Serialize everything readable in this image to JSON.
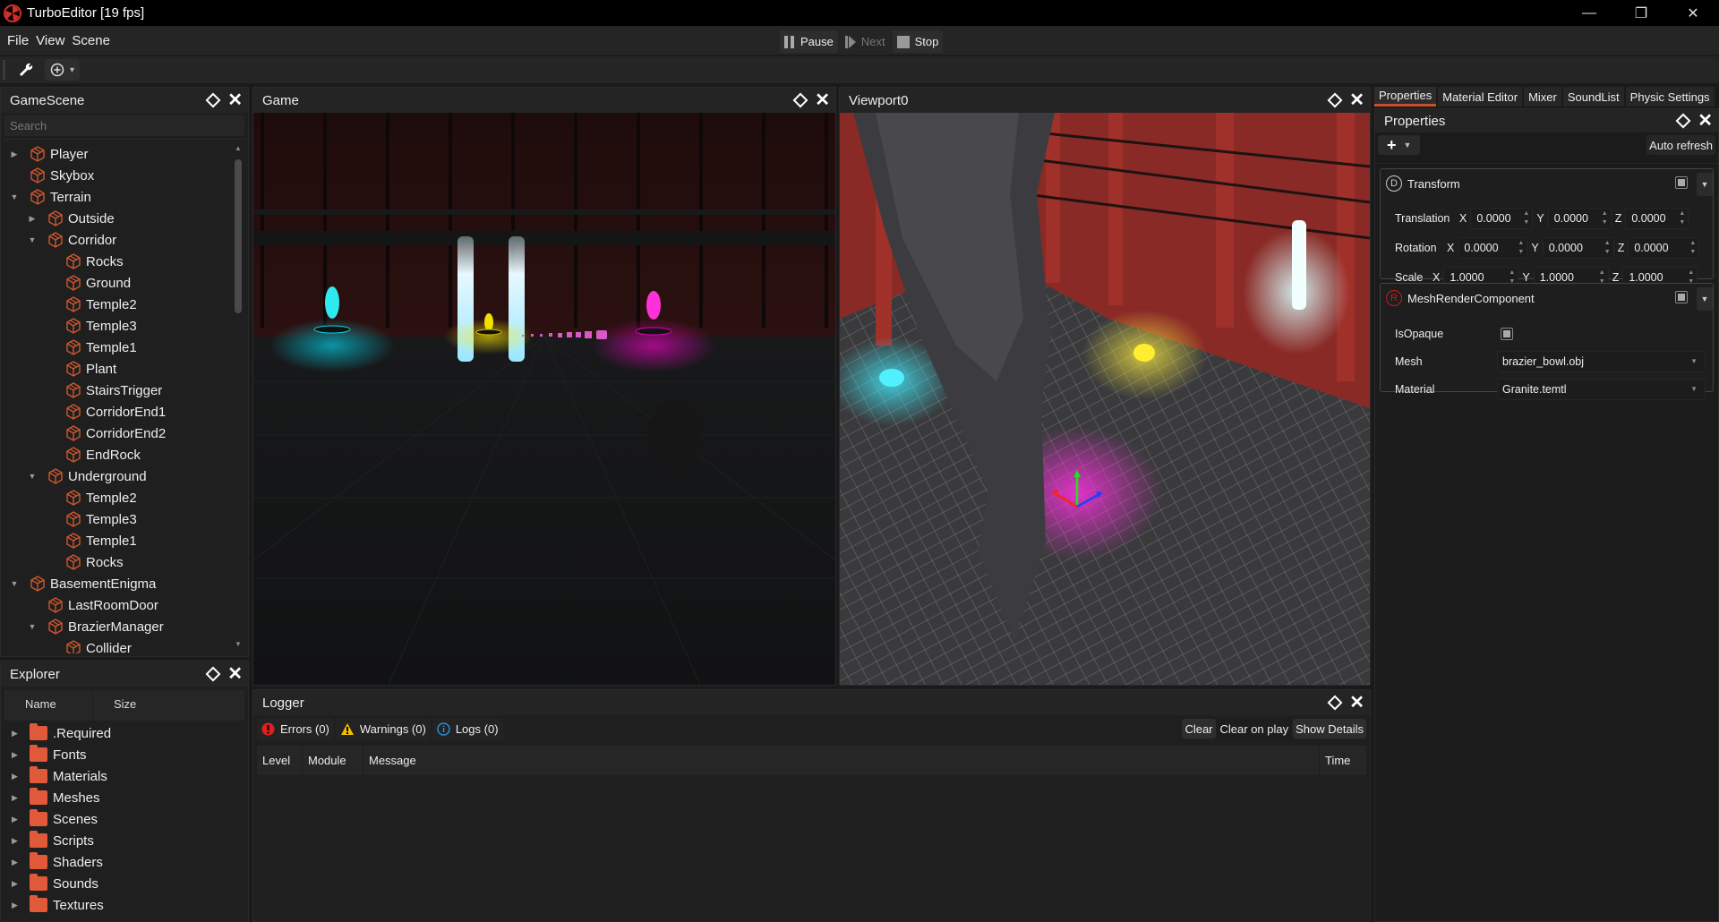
{
  "window": {
    "title": "TurboEditor [19 fps]",
    "controls": {
      "minimize": "—",
      "restore": "❐",
      "close": "✕"
    }
  },
  "menu": [
    "File",
    "View",
    "Scene"
  ],
  "playback": {
    "pause": "Pause",
    "next": "Next",
    "stop": "Stop"
  },
  "toolbar": {
    "tool_icon": "wrench-icon",
    "add_icon": "circle-plus-icon",
    "dropdown": "▾"
  },
  "scene_panel": {
    "title": "GameScene",
    "search_placeholder": "Search",
    "tree": [
      {
        "label": "Player",
        "depth": 0,
        "arrow": "collapsed"
      },
      {
        "label": "Skybox",
        "depth": 0,
        "arrow": "none"
      },
      {
        "label": "Terrain",
        "depth": 0,
        "arrow": "expanded"
      },
      {
        "label": "Outside",
        "depth": 1,
        "arrow": "collapsed"
      },
      {
        "label": "Corridor",
        "depth": 1,
        "arrow": "expanded"
      },
      {
        "label": "Rocks",
        "depth": 2,
        "arrow": "none"
      },
      {
        "label": "Ground",
        "depth": 2,
        "arrow": "none"
      },
      {
        "label": "Temple2",
        "depth": 2,
        "arrow": "none"
      },
      {
        "label": "Temple3",
        "depth": 2,
        "arrow": "none"
      },
      {
        "label": "Temple1",
        "depth": 2,
        "arrow": "none"
      },
      {
        "label": "Plant",
        "depth": 2,
        "arrow": "none"
      },
      {
        "label": "StairsTrigger",
        "depth": 2,
        "arrow": "none"
      },
      {
        "label": "CorridorEnd1",
        "depth": 2,
        "arrow": "none"
      },
      {
        "label": "CorridorEnd2",
        "depth": 2,
        "arrow": "none"
      },
      {
        "label": "EndRock",
        "depth": 2,
        "arrow": "none"
      },
      {
        "label": "Underground",
        "depth": 1,
        "arrow": "expanded"
      },
      {
        "label": "Temple2",
        "depth": 2,
        "arrow": "none"
      },
      {
        "label": "Temple3",
        "depth": 2,
        "arrow": "none"
      },
      {
        "label": "Temple1",
        "depth": 2,
        "arrow": "none"
      },
      {
        "label": "Rocks",
        "depth": 2,
        "arrow": "none"
      },
      {
        "label": "BasementEnigma",
        "depth": 0,
        "arrow": "expanded"
      },
      {
        "label": "LastRoomDoor",
        "depth": 1,
        "arrow": "none"
      },
      {
        "label": "BrazierManager",
        "depth": 1,
        "arrow": "expanded"
      },
      {
        "label": "Collider",
        "depth": 2,
        "arrow": "none"
      }
    ]
  },
  "explorer": {
    "title": "Explorer",
    "columns": [
      "Name",
      "Size"
    ],
    "folders": [
      ".Required",
      "Fonts",
      "Materials",
      "Meshes",
      "Scenes",
      "Scripts",
      "Shaders",
      "Sounds",
      "Textures"
    ]
  },
  "game_panel": {
    "title": "Game"
  },
  "viewport_panel": {
    "title": "Viewport0"
  },
  "logger": {
    "title": "Logger",
    "filters": [
      {
        "label": "Errors (0)",
        "icon": "error-icon",
        "color": "#e02020"
      },
      {
        "label": "Warnings (0)",
        "icon": "warning-icon",
        "color": "#f0c000"
      },
      {
        "label": "Logs (0)",
        "icon": "info-icon",
        "color": "#2a8fd6"
      }
    ],
    "buttons": [
      "Clear",
      "Clear on play",
      "Show Details"
    ],
    "columns": [
      "Level",
      "Module",
      "Message",
      "Time"
    ]
  },
  "right_tabs": [
    {
      "label": "Properties",
      "active": true
    },
    {
      "label": "Material Editor",
      "active": false
    },
    {
      "label": "Mixer",
      "active": false
    },
    {
      "label": "SoundList",
      "active": false
    },
    {
      "label": "Physic Settings",
      "active": false
    }
  ],
  "properties": {
    "title": "Properties",
    "add_label": "+",
    "auto_refresh": "Auto refresh",
    "transform": {
      "name": "Transform",
      "badge": "D",
      "rows": [
        {
          "label": "Translation",
          "x": "0.0000",
          "y": "0.0000",
          "z": "0.0000"
        },
        {
          "label": "Rotation",
          "x": "0.0000",
          "y": "0.0000",
          "z": "0.0000"
        },
        {
          "label": "Scale",
          "x": "1.0000",
          "y": "1.0000",
          "z": "1.0000"
        }
      ],
      "axis_labels": [
        "X",
        "Y",
        "Z"
      ]
    },
    "mesh_render": {
      "name": "MeshRenderComponent",
      "badge": "R",
      "is_opaque_label": "IsOpaque",
      "is_opaque": true,
      "mesh_label": "Mesh",
      "mesh_value": "brazier_bowl.obj",
      "material_label": "Material",
      "material_value": "Granite.temtl"
    }
  },
  "colors": {
    "accent": "#c3532e",
    "folder": "#e05a3a",
    "node_icon": "#d0562e"
  }
}
